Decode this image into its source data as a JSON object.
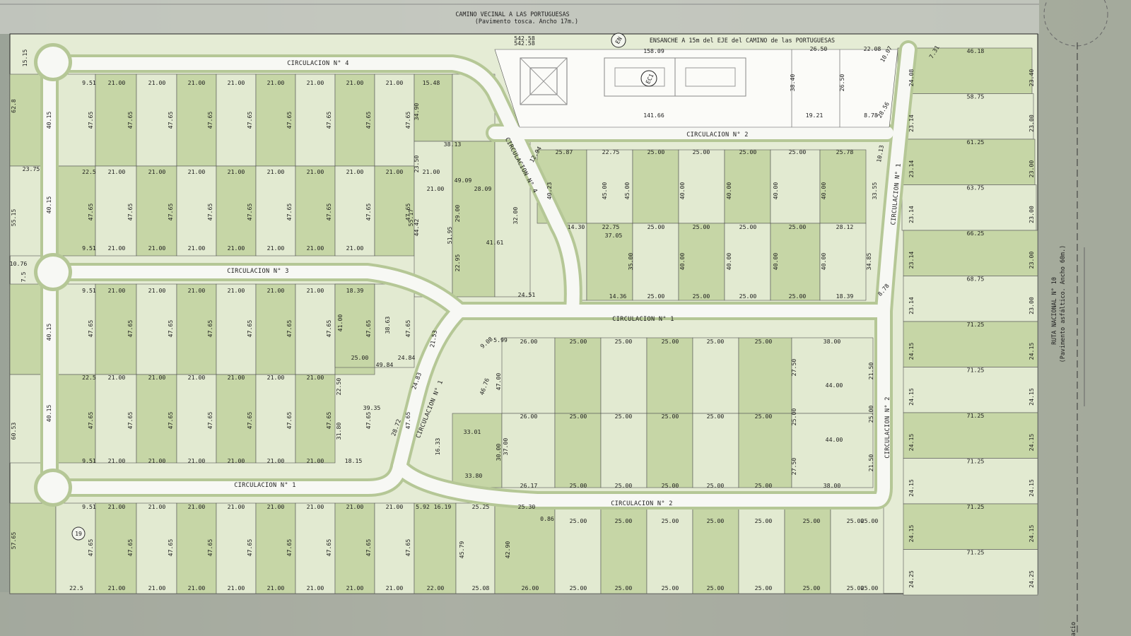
{
  "header": {
    "road_name": "CAMINO VECINAL A LAS PORTUGUESAS",
    "road_note": "(Pavimento tosca. Ancho 17m.)",
    "widening_note": "ENSANCHE A 15m del EJE del CAMINO de las PORTUGUESAS",
    "elev_1": "542.58",
    "elev_2": "542.58",
    "north_mark": "EN"
  },
  "right_road": {
    "name": "RUTA NACIONAL N° 10",
    "note": "(Pavimento asfáltico. Ancho 60m.)",
    "bottom_fragment": "acio"
  },
  "streets": {
    "c4": "CIRCULACION N° 4",
    "c3": "CIRCULACION N° 3",
    "c1": "CIRCULACION N° 1",
    "c2": "CIRCULACION N° 2",
    "c1_center": "CIRCULACION N° 1",
    "c2_bottom": "CIRCULACION N° 2",
    "c1_diag": "CIRCULACION N° 1",
    "c4_diag": "CIRCULACION N° 4",
    "c1_vertical": "CIRCULACION N° 1",
    "c2_vertical": "CIRCULACION N° 2"
  },
  "facility": {
    "label": "EC1",
    "dim_top": "158.09",
    "dim_bottom": "141.66"
  },
  "block_number": "19",
  "colors": {
    "lot_dark": "#c6d6a6",
    "lot_light": "#e2ead1",
    "road": "#f7f8f4",
    "road_edge": "#b5c796",
    "line": "#555555",
    "aerial": "#b6bab0"
  },
  "west_block_widths": [
    "21.00",
    "21.00",
    "21.00",
    "21.00",
    "21.00",
    "21.00",
    "21.00",
    "21.00"
  ],
  "row_A_top": [
    "9.51",
    "21.00",
    "21.00",
    "21.00",
    "21.00",
    "21.00",
    "21.00",
    "21.00",
    "21.00",
    "15.48"
  ],
  "row_A_mid": [
    "22.5",
    "21.00",
    "21.00",
    "21.00",
    "21.00",
    "21.00",
    "21.00",
    "21.00",
    "21.00",
    "21.00"
  ],
  "row_A_bot": [
    "9.51",
    "21.00",
    "21.00",
    "21.00",
    "21.00",
    "21.00",
    "21.00",
    "21.00"
  ],
  "row_B_top": [
    "9.51",
    "21.00",
    "21.00",
    "21.00",
    "21.00",
    "21.00",
    "21.00",
    "18.39"
  ],
  "row_B_mid": [
    "22.5",
    "21.00",
    "21.00",
    "21.00",
    "21.00",
    "21.00",
    "21.00"
  ],
  "row_B_bot": [
    "9.51",
    "21.00",
    "21.00",
    "21.00",
    "21.00",
    "21.00",
    "21.00",
    "18.15"
  ],
  "row_C_top": [
    "9.51",
    "21.00",
    "21.00",
    "21.00",
    "21.00",
    "21.00",
    "21.00",
    "21.00",
    "21.00",
    "5.92",
    "16.19",
    "25.25",
    "25.30"
  ],
  "row_C_bot": [
    "22.5",
    "21.00",
    "21.00",
    "21.00",
    "21.00",
    "21.00",
    "21.00",
    "21.00",
    "21.00",
    "22.00",
    "25.08",
    "26.00"
  ],
  "depth_47_65": "47.65",
  "depth_40_15": "40.15",
  "east_strip": [
    "46.18",
    "58.75",
    "61.25",
    "63.75",
    "66.25",
    "68.75",
    "71.25",
    "71.25",
    "71.25",
    "71.25",
    "71.25",
    "71.25"
  ],
  "east_depths_left": [
    "24.08",
    "23.14",
    "23.14",
    "23.14",
    "23.14",
    "23.14",
    "24.15",
    "24.15",
    "24.15",
    "24.15",
    "24.15",
    "24.25"
  ],
  "east_depths_right": [
    "23.40",
    "23.00",
    "23.00",
    "23.00",
    "23.00",
    "23.00",
    "24.15",
    "24.15",
    "24.15",
    "24.15",
    "24.15",
    "24.25"
  ],
  "ne_block_top": [
    "25.87",
    "22.75",
    "25.00",
    "25.00",
    "25.00",
    "25.00",
    "25.78"
  ],
  "ne_block_mid": [
    "14.30",
    "22.75",
    "25.00",
    "25.00",
    "25.00",
    "25.00",
    "28.12"
  ],
  "ne_block_bot": [
    "14.36",
    "25.00",
    "25.00",
    "25.00",
    "25.00",
    "18.39"
  ],
  "ne_depths": [
    "40.23",
    "45.00",
    "45.00",
    "40.00",
    "40.00",
    "40.00",
    "40.00",
    "33.55",
    "35.00",
    "40.00",
    "40.00",
    "40.00",
    "40.00",
    "34.85"
  ],
  "center_block_top": [
    "26.00",
    "25.00",
    "25.00",
    "25.00",
    "25.00",
    "25.00",
    "38.00"
  ],
  "center_block_mid": [
    "26.00",
    "25.00",
    "25.00",
    "25.00",
    "25.00",
    "25.00"
  ],
  "center_block_bot": [
    "26.17",
    "25.00",
    "25.00",
    "25.00",
    "25.00",
    "25.00",
    "38.00"
  ],
  "center_side": [
    "44.00",
    "44.00",
    "27.50",
    "25.00",
    "27.50",
    "21.50",
    "25.00",
    "21.50"
  ],
  "south_block_top": [
    "25.00",
    "25.00",
    "25.00",
    "25.00",
    "25.00",
    "25.00",
    "25.00",
    "25.00"
  ],
  "south_block_bot": [
    "25.00",
    "25.00",
    "25.00",
    "25.00",
    "25.00",
    "25.00",
    "25.00",
    "25.00"
  ],
  "misc": [
    "38.13",
    "49.09",
    "28.09",
    "41.61",
    "21.00",
    "29.00",
    "22.95",
    "24.51",
    "32.00",
    "34.90",
    "23.50",
    "55.17",
    "44.42",
    "51.95",
    "38.63",
    "24.84",
    "49.84",
    "25.00",
    "39.35",
    "22.50",
    "31.80",
    "33.01",
    "33.80",
    "16.33",
    "30.00",
    "37.00",
    "47.00",
    "46.76",
    "5.99",
    "9.08",
    "24.83",
    "21.53",
    "28.72",
    "41.00",
    "62.8",
    "55.15",
    "23.75",
    "10.76",
    "7.5",
    "60.53",
    "57.65",
    "15.15",
    "26.50",
    "22.08",
    "38.40",
    "26.50",
    "19.21",
    "8.78",
    "28.56",
    "10.07",
    "7.31",
    "12.94",
    "10.13",
    "37.05",
    "8.78",
    "45.79",
    "42.90",
    "0.86"
  ]
}
